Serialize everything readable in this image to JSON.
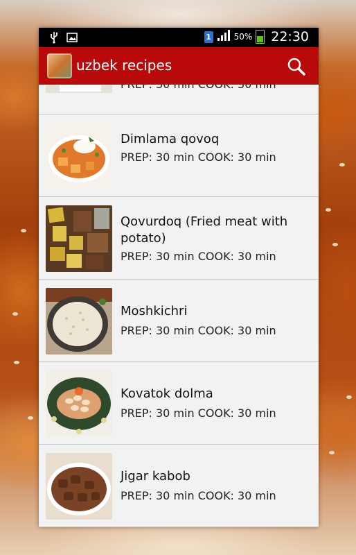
{
  "status_bar": {
    "sim_label": "1",
    "battery": "50%",
    "time": "22:30"
  },
  "app": {
    "title": "uzbek recipes",
    "icons": {
      "search": "search-icon",
      "app": "app-logo-icon"
    }
  },
  "partial_row": {
    "meta": "PREP: 30 min  COOK: 30 min"
  },
  "recipes": [
    {
      "title": "Dimlama qovoq",
      "meta": "PREP: 30 min  COOK: 30 min"
    },
    {
      "title": "Qovurdoq (Fried meat with potato)",
      "meta": "PREP: 30 min  COOK: 30 min"
    },
    {
      "title": "Moshkichri",
      "meta": "PREP: 30 min  COOK: 30 min"
    },
    {
      "title": "Kovatok dolma",
      "meta": "PREP: 30 min  COOK: 30 min"
    },
    {
      "title": "Jigar kabob",
      "meta": "PREP: 30 min  COOK: 30 min"
    }
  ],
  "colors": {
    "action_bar": "#b80a0a",
    "list_bg": "#f2f2f2"
  }
}
